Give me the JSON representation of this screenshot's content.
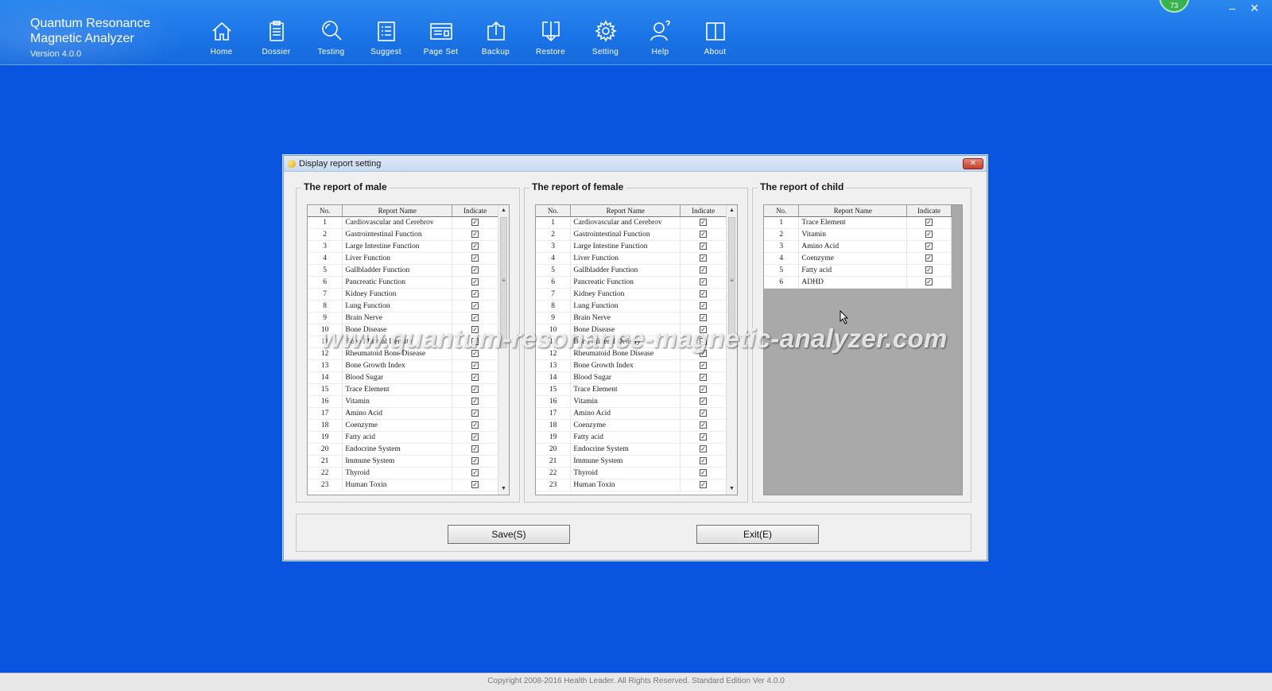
{
  "app": {
    "title_line1": "Quantum Resonance",
    "title_line2": "Magnetic Analyzer",
    "version": "Version 4.0.0",
    "badge": "73"
  },
  "nav": [
    {
      "label": "Home",
      "icon": "home-icon"
    },
    {
      "label": "Dossier",
      "icon": "clipboard-icon"
    },
    {
      "label": "Testing",
      "icon": "magnifier-icon"
    },
    {
      "label": "Suggest",
      "icon": "list-icon"
    },
    {
      "label": "Page Set",
      "icon": "page-layout-icon"
    },
    {
      "label": "Backup",
      "icon": "upload-icon"
    },
    {
      "label": "Restore",
      "icon": "download-icon"
    },
    {
      "label": "Setting",
      "icon": "gear-icon"
    },
    {
      "label": "Help",
      "icon": "user-help-icon"
    },
    {
      "label": "About",
      "icon": "book-icon"
    }
  ],
  "window_controls": {
    "minimize": "–",
    "close": "✕"
  },
  "dialog": {
    "title": "Display report setting",
    "close": "✕",
    "columns": {
      "no": "No.",
      "name": "Report Name",
      "indicate": "Indicate"
    },
    "male": {
      "title": "The report of male",
      "rows": [
        {
          "no": "1",
          "name": "Cardiovascular and Cerebrov",
          "checked": true
        },
        {
          "no": "2",
          "name": "Gastrointestinal Function",
          "checked": true
        },
        {
          "no": "3",
          "name": "Large Intestine Function",
          "checked": true
        },
        {
          "no": "4",
          "name": "Liver Function",
          "checked": true
        },
        {
          "no": "5",
          "name": "Gallbladder Function",
          "checked": true
        },
        {
          "no": "6",
          "name": "Pancreatic Function",
          "checked": true
        },
        {
          "no": "7",
          "name": "Kidney Function",
          "checked": true
        },
        {
          "no": "8",
          "name": "Lung Function",
          "checked": true
        },
        {
          "no": "9",
          "name": "Brain Nerve",
          "checked": true
        },
        {
          "no": "10",
          "name": "Bone Disease",
          "checked": true
        },
        {
          "no": "11",
          "name": "Bone Mineral Density",
          "checked": true
        },
        {
          "no": "12",
          "name": "Rheumatoid Bone Disease",
          "checked": true
        },
        {
          "no": "13",
          "name": "Bone Growth Index",
          "checked": true
        },
        {
          "no": "14",
          "name": "Blood Sugar",
          "checked": true
        },
        {
          "no": "15",
          "name": "Trace Element",
          "checked": true
        },
        {
          "no": "16",
          "name": "Vitamin",
          "checked": true
        },
        {
          "no": "17",
          "name": "Amino Acid",
          "checked": true
        },
        {
          "no": "18",
          "name": "Coenzyme",
          "checked": true
        },
        {
          "no": "19",
          "name": "Fatty acid",
          "checked": true
        },
        {
          "no": "20",
          "name": "Endocrine System",
          "checked": true
        },
        {
          "no": "21",
          "name": "Immune System",
          "checked": true
        },
        {
          "no": "22",
          "name": "Thyroid",
          "checked": true
        },
        {
          "no": "23",
          "name": "Human Toxin",
          "checked": true
        }
      ]
    },
    "female": {
      "title": "The report of female",
      "rows": [
        {
          "no": "1",
          "name": "Cardiovascular and Cerebrov",
          "checked": true
        },
        {
          "no": "2",
          "name": "Gastrointestinal Function",
          "checked": true
        },
        {
          "no": "3",
          "name": "Large Intestine Function",
          "checked": true
        },
        {
          "no": "4",
          "name": "Liver Function",
          "checked": true
        },
        {
          "no": "5",
          "name": "Gallbladder Function",
          "checked": true
        },
        {
          "no": "6",
          "name": "Pancreatic Function",
          "checked": true
        },
        {
          "no": "7",
          "name": "Kidney Function",
          "checked": true
        },
        {
          "no": "8",
          "name": "Lung Function",
          "checked": true
        },
        {
          "no": "9",
          "name": "Brain Nerve",
          "checked": true
        },
        {
          "no": "10",
          "name": "Bone Disease",
          "checked": true
        },
        {
          "no": "11",
          "name": "Bone Mineral Density",
          "checked": true
        },
        {
          "no": "12",
          "name": "Rheumatoid Bone Disease",
          "checked": true
        },
        {
          "no": "13",
          "name": "Bone Growth Index",
          "checked": true
        },
        {
          "no": "14",
          "name": "Blood Sugar",
          "checked": true
        },
        {
          "no": "15",
          "name": "Trace Element",
          "checked": true
        },
        {
          "no": "16",
          "name": "Vitamin",
          "checked": true
        },
        {
          "no": "17",
          "name": "Amino Acid",
          "checked": true
        },
        {
          "no": "18",
          "name": "Coenzyme",
          "checked": true
        },
        {
          "no": "19",
          "name": "Fatty acid",
          "checked": true
        },
        {
          "no": "20",
          "name": "Endocrine System",
          "checked": true
        },
        {
          "no": "21",
          "name": "Immune System",
          "checked": true
        },
        {
          "no": "22",
          "name": "Thyroid",
          "checked": true
        },
        {
          "no": "23",
          "name": "Human Toxin",
          "checked": true
        }
      ]
    },
    "child": {
      "title": "The report of child",
      "rows": [
        {
          "no": "1",
          "name": "Trace Element",
          "checked": true
        },
        {
          "no": "2",
          "name": "Vitamin",
          "checked": true
        },
        {
          "no": "3",
          "name": "Amino Acid",
          "checked": true
        },
        {
          "no": "4",
          "name": "Coenzyme",
          "checked": true
        },
        {
          "no": "5",
          "name": "Fatty acid",
          "checked": true
        },
        {
          "no": "6",
          "name": "ADHD",
          "checked": true
        }
      ]
    },
    "save_label": "Save(S)",
    "exit_label": "Exit(E)"
  },
  "watermark": "www.quantum-resonance-magnetic-analyzer.com",
  "footer": "Copyright 2008-2016 Health Leader. All Rights Reserved.  Standard Edition Ver 4.0.0",
  "colors": {
    "desktop": "#0a55e0",
    "topbar": "#1a73e6",
    "dialog": "#f0f0f0",
    "child_grid_bg": "#a9a9a9"
  }
}
